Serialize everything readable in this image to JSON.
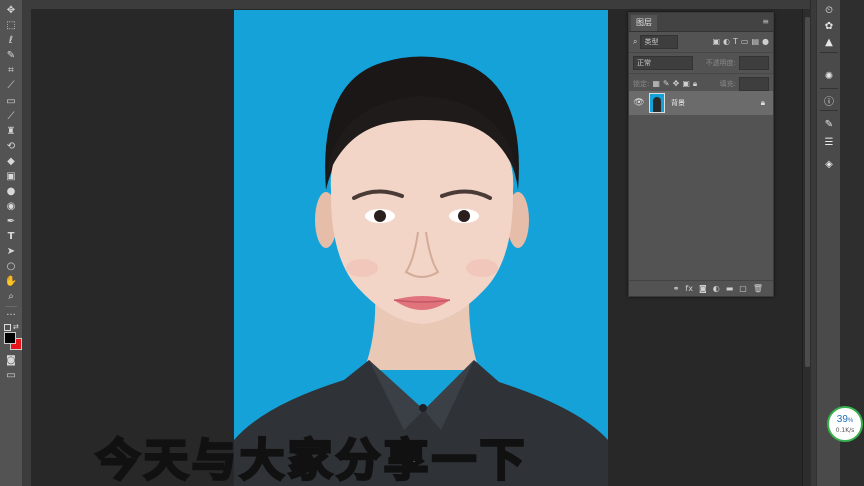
{
  "toolbar": {
    "tools": [
      "move-tool",
      "marquee-tool",
      "lasso-tool",
      "quick-select-tool",
      "crop-tool",
      "eyedropper-tool",
      "healing-brush-tool",
      "brush-tool",
      "clone-stamp-tool",
      "history-brush-tool",
      "eraser-tool",
      "gradient-tool",
      "blur-tool",
      "dodge-tool",
      "pen-tool",
      "type-tool",
      "path-select-tool",
      "shape-tool",
      "hand-tool",
      "zoom-tool",
      "more-tools",
      "swap-colors"
    ],
    "colors": {
      "foreground": "#000000",
      "background": "#e8141b"
    }
  },
  "canvas": {
    "background_color": "#14a2d9"
  },
  "layers_panel": {
    "tab_title": "图层",
    "kind_filter": "类型",
    "blend_mode": "正常",
    "opacity_label": "不透明度:",
    "lock_label": "锁定:",
    "fill_label": "填充:",
    "layer": {
      "name": "背景"
    }
  },
  "right_panel_icons": [
    "history-icon",
    "brush-preset-icon",
    "tool-preset-icon",
    "color-icon",
    "swatches-icon",
    "info-icon",
    "brush-settings-icon",
    "adjustments-icon",
    "paths-icon"
  ],
  "network_widget": {
    "percent": "39",
    "percent_unit": "%",
    "speed": "0.1K/s"
  },
  "caption": {
    "text": "今天与大家分享一下"
  }
}
